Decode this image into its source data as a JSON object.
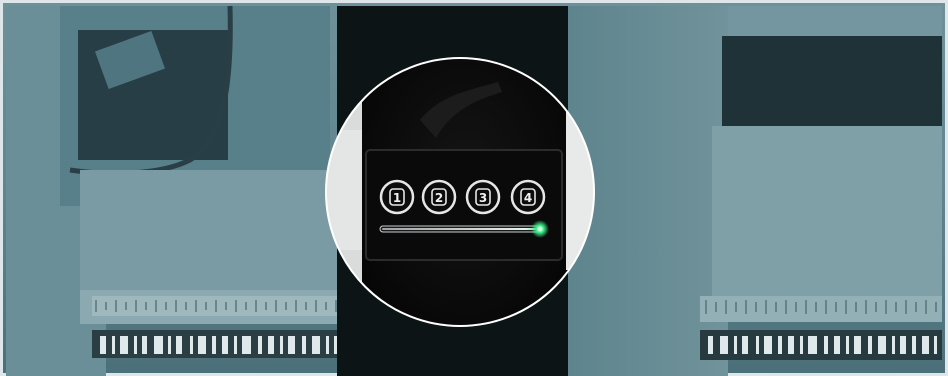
{
  "scene": {
    "tint_color": "#3b6670",
    "highlight_color": "#ffffff",
    "indicator_color": "#3cf08a"
  },
  "keypad": {
    "buttons": [
      {
        "label": "1"
      },
      {
        "label": "2"
      },
      {
        "label": "3"
      },
      {
        "label": "4"
      }
    ],
    "status_led": "green"
  }
}
